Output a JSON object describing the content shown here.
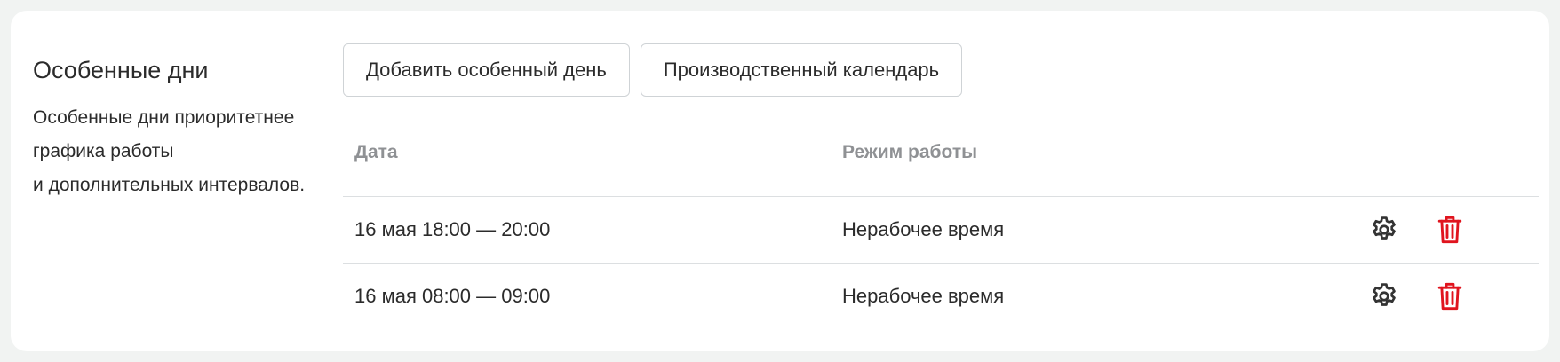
{
  "section": {
    "title": "Особенные дни",
    "description": [
      "Особенные дни приоритетнее",
      "графика работы",
      "и дополнительных интервалов."
    ]
  },
  "buttons": {
    "add_special_day": "Добавить особенный день",
    "production_calendar": "Производственный календарь"
  },
  "table": {
    "headers": {
      "date": "Дата",
      "mode": "Режим работы"
    },
    "rows": [
      {
        "date": "16 мая 18:00 — 20:00",
        "mode": "Нерабочее время"
      },
      {
        "date": "16 мая 08:00 — 09:00",
        "mode": "Нерабочее время"
      }
    ]
  },
  "icons": {
    "settings": "gear-icon",
    "delete": "trash-icon"
  },
  "colors": {
    "background": "#f1f3f2",
    "card": "#ffffff",
    "text": "#2b2b2b",
    "header_text": "#8f9194",
    "delete_icon": "#e0141e",
    "gear_icon": "#333333"
  }
}
